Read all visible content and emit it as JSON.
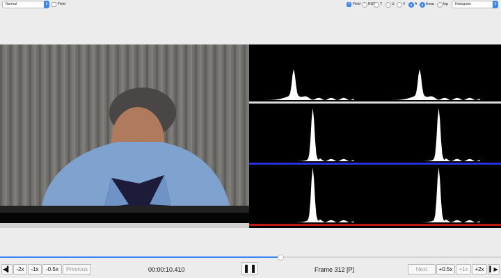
{
  "toolbar": {
    "mode_select": "Normal",
    "field_left": "Field",
    "field_right": "Field",
    "rgb": "RGB",
    "y": "Y",
    "u": "U",
    "v": "V",
    "a": "A",
    "linear": "linear",
    "log": "log",
    "view_select": "Histogram"
  },
  "controls": {
    "m2x": "-2x",
    "m1x": "-1x",
    "m05x": "-0.5x",
    "previous": "Previous",
    "timecode": "00:00:10.410",
    "frame": "Frame 312 [P]",
    "next": "Next",
    "p05x": "+0.5x",
    "p1x": "+1x",
    "p2x": "+2x"
  },
  "playback_progress": 0.56,
  "histogram_series": [
    {
      "name": "Luma",
      "accent": "#ffffff"
    },
    {
      "name": "Luma",
      "accent": "#ffffff"
    },
    {
      "name": "Blue",
      "accent": "#2b3cff"
    },
    {
      "name": "Blue",
      "accent": "#2b3cff"
    },
    {
      "name": "Red",
      "accent": "#e01e1e"
    },
    {
      "name": "Red",
      "accent": "#e01e1e"
    }
  ],
  "icons": {
    "play_back": "step-back-icon",
    "pause": "pause-icon",
    "play_fwd": "step-forward-icon"
  }
}
